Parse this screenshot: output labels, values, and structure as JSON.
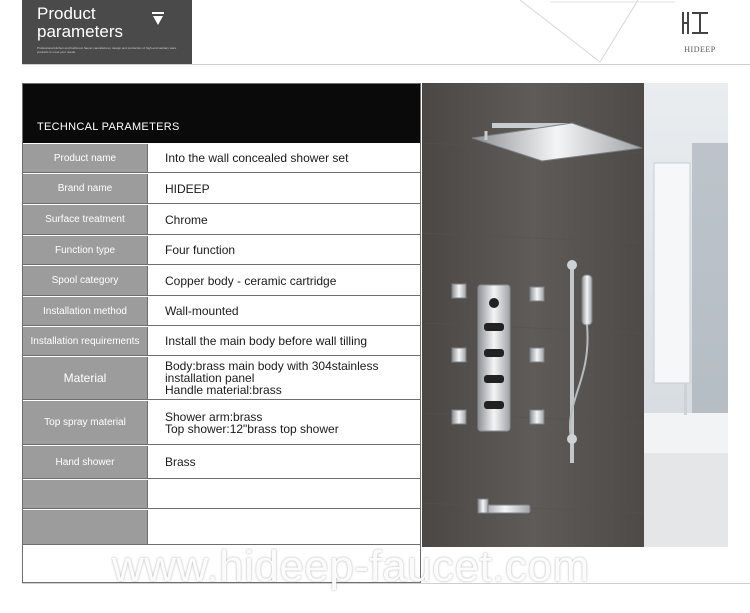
{
  "header": {
    "title_line1": "Product",
    "title_line2": "parameters",
    "subtitle": "Professional kitchen and bathroom faucet manufacturer, design and production of high-end sanitary ware products to meet your needs",
    "arrow_icon": "down-triangle-icon"
  },
  "logo": {
    "text": "HIDEEP"
  },
  "table": {
    "heading": "TECHNCAL PARAMETERS",
    "rows": [
      {
        "label": "Product name",
        "value": "Into the wall concealed shower set"
      },
      {
        "label": "Brand name",
        "value": "HIDEEP"
      },
      {
        "label": "Surface treatment",
        "value": "Chrome"
      },
      {
        "label": "Function type",
        "value": "Four function"
      },
      {
        "label": "Spool category",
        "value": "Copper body - ceramic cartridge"
      },
      {
        "label": "Installation method",
        "value": "Wall-mounted"
      },
      {
        "label": "Installation requirements",
        "value": "Install the main body before wall tilling"
      },
      {
        "label": "Material",
        "value": "Body:brass main body with 304stainless\ninstallation panel\nHandle material:brass"
      },
      {
        "label": "Top spray material",
        "value": "Shower arm:brass\nTop shower:12\"brass top shower"
      },
      {
        "label": "Hand shower",
        "value": "Brass"
      },
      {
        "label": "",
        "value": ""
      },
      {
        "label": "",
        "value": ""
      }
    ]
  },
  "watermark": "www.hideep-faucet.com",
  "colors": {
    "label_bg": "#9c9c9c",
    "header_bg": "#0a0a0a",
    "tab_bg": "#4a4a4a"
  }
}
